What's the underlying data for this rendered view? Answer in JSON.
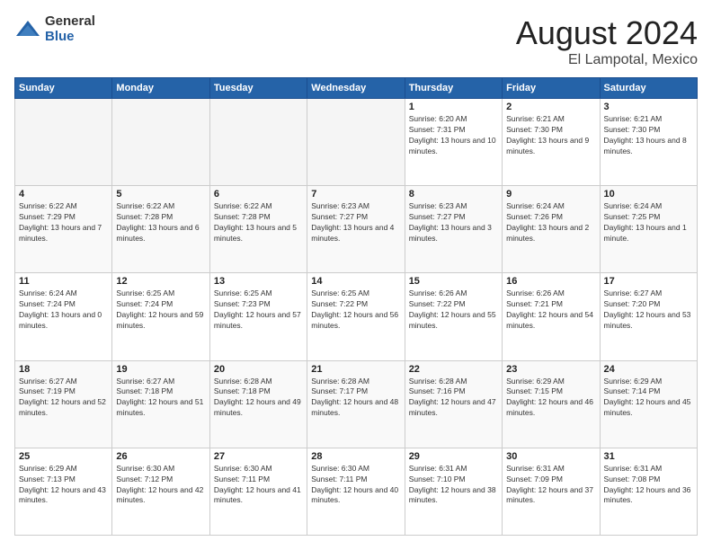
{
  "logo": {
    "general": "General",
    "blue": "Blue"
  },
  "header": {
    "month": "August 2024",
    "location": "El Lampotal, Mexico"
  },
  "weekdays": [
    "Sunday",
    "Monday",
    "Tuesday",
    "Wednesday",
    "Thursday",
    "Friday",
    "Saturday"
  ],
  "weeks": [
    [
      {
        "day": "",
        "empty": true
      },
      {
        "day": "",
        "empty": true
      },
      {
        "day": "",
        "empty": true
      },
      {
        "day": "",
        "empty": true
      },
      {
        "day": "1",
        "sunrise": "6:20 AM",
        "sunset": "7:31 PM",
        "daylight": "13 hours and 10 minutes."
      },
      {
        "day": "2",
        "sunrise": "6:21 AM",
        "sunset": "7:30 PM",
        "daylight": "13 hours and 9 minutes."
      },
      {
        "day": "3",
        "sunrise": "6:21 AM",
        "sunset": "7:30 PM",
        "daylight": "13 hours and 8 minutes."
      }
    ],
    [
      {
        "day": "4",
        "sunrise": "6:22 AM",
        "sunset": "7:29 PM",
        "daylight": "13 hours and 7 minutes."
      },
      {
        "day": "5",
        "sunrise": "6:22 AM",
        "sunset": "7:28 PM",
        "daylight": "13 hours and 6 minutes."
      },
      {
        "day": "6",
        "sunrise": "6:22 AM",
        "sunset": "7:28 PM",
        "daylight": "13 hours and 5 minutes."
      },
      {
        "day": "7",
        "sunrise": "6:23 AM",
        "sunset": "7:27 PM",
        "daylight": "13 hours and 4 minutes."
      },
      {
        "day": "8",
        "sunrise": "6:23 AM",
        "sunset": "7:27 PM",
        "daylight": "13 hours and 3 minutes."
      },
      {
        "day": "9",
        "sunrise": "6:24 AM",
        "sunset": "7:26 PM",
        "daylight": "13 hours and 2 minutes."
      },
      {
        "day": "10",
        "sunrise": "6:24 AM",
        "sunset": "7:25 PM",
        "daylight": "13 hours and 1 minute."
      }
    ],
    [
      {
        "day": "11",
        "sunrise": "6:24 AM",
        "sunset": "7:24 PM",
        "daylight": "13 hours and 0 minutes."
      },
      {
        "day": "12",
        "sunrise": "6:25 AM",
        "sunset": "7:24 PM",
        "daylight": "12 hours and 59 minutes."
      },
      {
        "day": "13",
        "sunrise": "6:25 AM",
        "sunset": "7:23 PM",
        "daylight": "12 hours and 57 minutes."
      },
      {
        "day": "14",
        "sunrise": "6:25 AM",
        "sunset": "7:22 PM",
        "daylight": "12 hours and 56 minutes."
      },
      {
        "day": "15",
        "sunrise": "6:26 AM",
        "sunset": "7:22 PM",
        "daylight": "12 hours and 55 minutes."
      },
      {
        "day": "16",
        "sunrise": "6:26 AM",
        "sunset": "7:21 PM",
        "daylight": "12 hours and 54 minutes."
      },
      {
        "day": "17",
        "sunrise": "6:27 AM",
        "sunset": "7:20 PM",
        "daylight": "12 hours and 53 minutes."
      }
    ],
    [
      {
        "day": "18",
        "sunrise": "6:27 AM",
        "sunset": "7:19 PM",
        "daylight": "12 hours and 52 minutes."
      },
      {
        "day": "19",
        "sunrise": "6:27 AM",
        "sunset": "7:18 PM",
        "daylight": "12 hours and 51 minutes."
      },
      {
        "day": "20",
        "sunrise": "6:28 AM",
        "sunset": "7:18 PM",
        "daylight": "12 hours and 49 minutes."
      },
      {
        "day": "21",
        "sunrise": "6:28 AM",
        "sunset": "7:17 PM",
        "daylight": "12 hours and 48 minutes."
      },
      {
        "day": "22",
        "sunrise": "6:28 AM",
        "sunset": "7:16 PM",
        "daylight": "12 hours and 47 minutes."
      },
      {
        "day": "23",
        "sunrise": "6:29 AM",
        "sunset": "7:15 PM",
        "daylight": "12 hours and 46 minutes."
      },
      {
        "day": "24",
        "sunrise": "6:29 AM",
        "sunset": "7:14 PM",
        "daylight": "12 hours and 45 minutes."
      }
    ],
    [
      {
        "day": "25",
        "sunrise": "6:29 AM",
        "sunset": "7:13 PM",
        "daylight": "12 hours and 43 minutes."
      },
      {
        "day": "26",
        "sunrise": "6:30 AM",
        "sunset": "7:12 PM",
        "daylight": "12 hours and 42 minutes."
      },
      {
        "day": "27",
        "sunrise": "6:30 AM",
        "sunset": "7:11 PM",
        "daylight": "12 hours and 41 minutes."
      },
      {
        "day": "28",
        "sunrise": "6:30 AM",
        "sunset": "7:11 PM",
        "daylight": "12 hours and 40 minutes."
      },
      {
        "day": "29",
        "sunrise": "6:31 AM",
        "sunset": "7:10 PM",
        "daylight": "12 hours and 38 minutes."
      },
      {
        "day": "30",
        "sunrise": "6:31 AM",
        "sunset": "7:09 PM",
        "daylight": "12 hours and 37 minutes."
      },
      {
        "day": "31",
        "sunrise": "6:31 AM",
        "sunset": "7:08 PM",
        "daylight": "12 hours and 36 minutes."
      }
    ]
  ],
  "labels": {
    "sunrise": "Sunrise:",
    "sunset": "Sunset:",
    "daylight": "Daylight hours"
  }
}
